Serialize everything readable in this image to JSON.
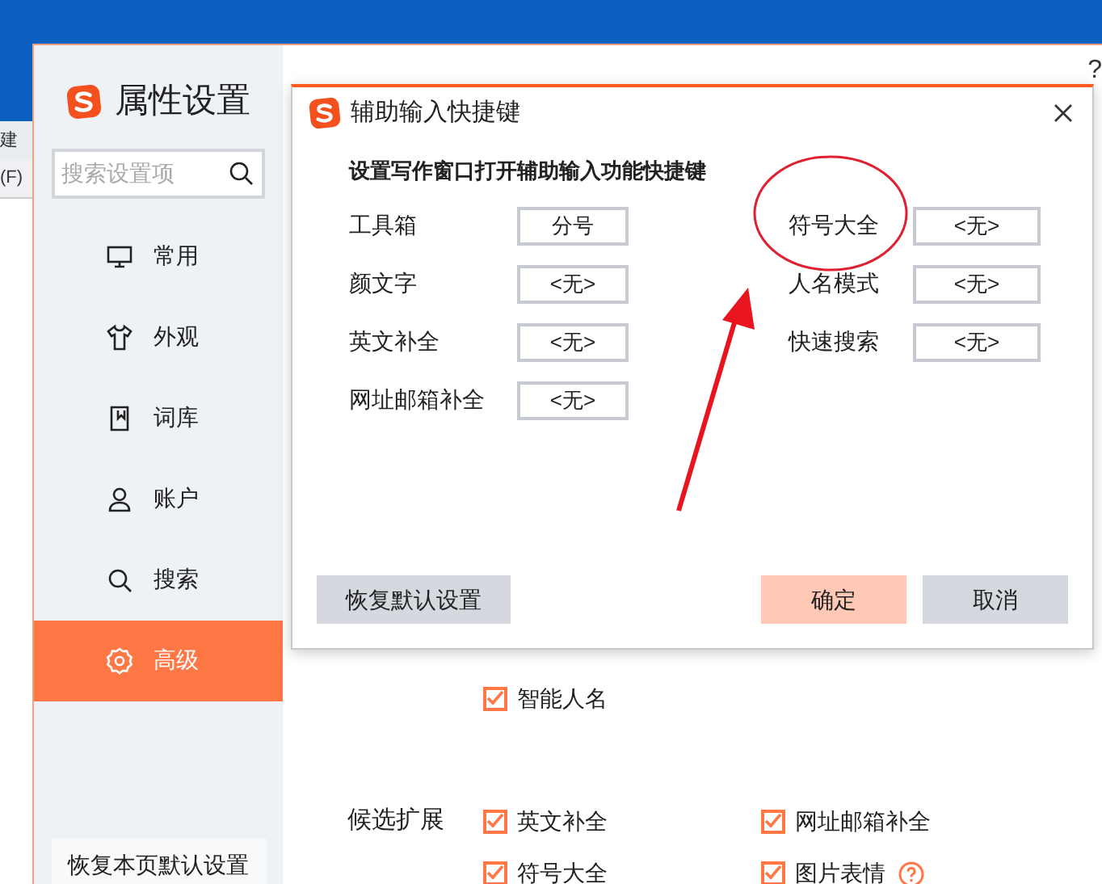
{
  "background_window": {
    "texts": [
      "建",
      "(F)"
    ]
  },
  "settings": {
    "title": "属性设置",
    "help": "?",
    "search": {
      "placeholder": "搜索设置项"
    },
    "nav": [
      {
        "label": "常用",
        "selected": false
      },
      {
        "label": "外观",
        "selected": false
      },
      {
        "label": "词库",
        "selected": false
      },
      {
        "label": "账户",
        "selected": false
      },
      {
        "label": "搜索",
        "selected": false
      },
      {
        "label": "高级",
        "selected": true
      }
    ],
    "reset_button": "恢复本页默认设置",
    "option_rows": [
      {
        "items": [
          {
            "label": "智能人名",
            "checked": true
          }
        ]
      },
      {
        "label": "候选扩展",
        "items": [
          {
            "label": "英文补全",
            "checked": true
          },
          {
            "label": "网址邮箱补全",
            "checked": true
          }
        ]
      },
      {
        "items": [
          {
            "label": "符号大全",
            "checked": true
          },
          {
            "label": "图片表情",
            "checked": true,
            "help": true
          }
        ]
      }
    ]
  },
  "dialog": {
    "title": "辅助输入快捷键",
    "heading": "设置写作窗口打开辅助输入功能快捷键",
    "shortcuts": [
      {
        "label": "工具箱",
        "value": "分号"
      },
      {
        "label": "颜文字",
        "value": "<无>"
      },
      {
        "label": "英文补全",
        "value": "<无>"
      },
      {
        "label": "网址邮箱补全",
        "value": "<无>"
      },
      {
        "label": "符号大全",
        "value": "<无>"
      },
      {
        "label": "人名模式",
        "value": "<无>"
      },
      {
        "label": "快速搜索",
        "value": "<无>"
      }
    ],
    "buttons": [
      {
        "label": "恢复默认设置",
        "kind": "reset"
      },
      {
        "label": "确定",
        "kind": "primary"
      },
      {
        "label": "取消",
        "kind": "cancel"
      }
    ]
  }
}
